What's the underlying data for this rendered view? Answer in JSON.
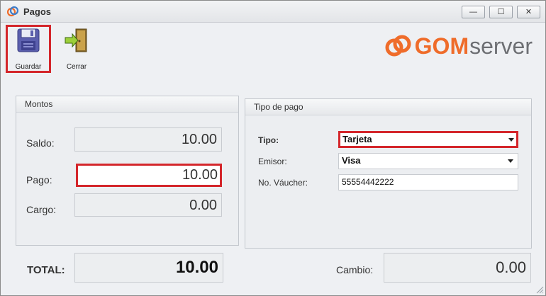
{
  "window": {
    "title": "Pagos",
    "controls": {
      "minimize": "—",
      "maximize": "☐",
      "close": "✕"
    }
  },
  "toolbar": {
    "save_label": "Guardar",
    "close_label": "Cerrar"
  },
  "logo": {
    "part1": "GOM",
    "part2": "server"
  },
  "montos": {
    "heading": "Montos",
    "saldo_label": "Saldo:",
    "saldo_value": "10.00",
    "pago_label": "Pago:",
    "pago_value": "10.00",
    "cargo_label": "Cargo:",
    "cargo_value": "0.00"
  },
  "tipo_pago": {
    "heading": "Tipo de pago",
    "tipo_label": "Tipo:",
    "tipo_value": "Tarjeta",
    "emisor_label": "Emisor:",
    "emisor_value": "Visa",
    "vaucher_label": "No. Váucher:",
    "vaucher_value": "55554442222"
  },
  "footer": {
    "total_label": "TOTAL:",
    "total_value": "10.00",
    "cambio_label": "Cambio:",
    "cambio_value": "0.00"
  },
  "colors": {
    "highlight": "#d4262b",
    "brand_orange": "#ef6c2a",
    "brand_gray": "#6d6f73"
  },
  "icons": [
    "app-logo-icon",
    "floppy-disk-icon",
    "exit-door-icon",
    "dropdown-arrow-icon",
    "resize-grip-icon"
  ]
}
